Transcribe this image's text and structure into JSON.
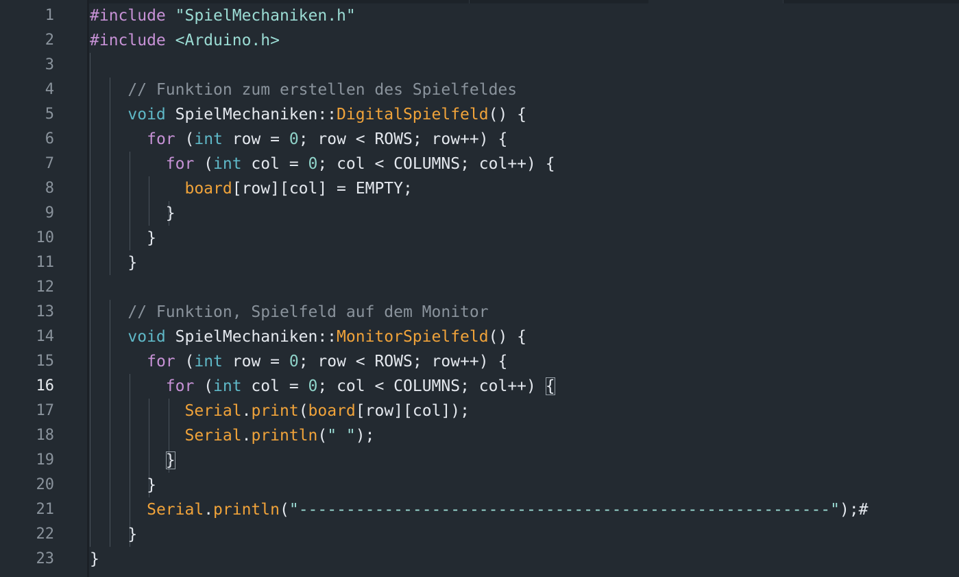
{
  "editor": {
    "active_line": 16,
    "colors": {
      "background": "#232a31",
      "keyword": "#c792d6",
      "string": "#9bdcd4",
      "type": "#5fb8c7",
      "function": "#f0a33a",
      "number": "#8fd3c9",
      "comment": "#8a939c",
      "plain": "#e4e8ee"
    },
    "lines": [
      {
        "num": "1",
        "tokens": [
          [
            "k",
            "#include"
          ],
          [
            "p",
            " "
          ],
          [
            "s",
            "\"SpielMechaniken.h\""
          ]
        ]
      },
      {
        "num": "2",
        "tokens": [
          [
            "k",
            "#include"
          ],
          [
            "p",
            " "
          ],
          [
            "s",
            "<Arduino.h>"
          ]
        ]
      },
      {
        "num": "3",
        "tokens": []
      },
      {
        "num": "4",
        "tokens": [
          [
            "p",
            "    "
          ],
          [
            "c",
            "// Funktion zum erstellen des Spielfeldes"
          ]
        ]
      },
      {
        "num": "5",
        "tokens": [
          [
            "p",
            "    "
          ],
          [
            "t",
            "void"
          ],
          [
            "p",
            " SpielMechaniken::"
          ],
          [
            "f",
            "DigitalSpielfeld"
          ],
          [
            "p",
            "() {"
          ]
        ]
      },
      {
        "num": "6",
        "tokens": [
          [
            "p",
            "      "
          ],
          [
            "k",
            "for"
          ],
          [
            "p",
            " ("
          ],
          [
            "t",
            "int"
          ],
          [
            "p",
            " row = "
          ],
          [
            "n",
            "0"
          ],
          [
            "p",
            "; row < ROWS; row++) {"
          ]
        ]
      },
      {
        "num": "7",
        "tokens": [
          [
            "p",
            "        "
          ],
          [
            "k",
            "for"
          ],
          [
            "p",
            " ("
          ],
          [
            "t",
            "int"
          ],
          [
            "p",
            " col = "
          ],
          [
            "n",
            "0"
          ],
          [
            "p",
            "; col < COLUMNS; col++) {"
          ]
        ]
      },
      {
        "num": "8",
        "tokens": [
          [
            "p",
            "          "
          ],
          [
            "f",
            "board"
          ],
          [
            "p",
            "[row][col] = EMPTY;"
          ]
        ]
      },
      {
        "num": "9",
        "tokens": [
          [
            "p",
            "        }"
          ]
        ]
      },
      {
        "num": "10",
        "tokens": [
          [
            "p",
            "      }"
          ]
        ]
      },
      {
        "num": "11",
        "tokens": [
          [
            "p",
            "    }"
          ]
        ]
      },
      {
        "num": "12",
        "tokens": []
      },
      {
        "num": "13",
        "tokens": [
          [
            "p",
            "    "
          ],
          [
            "c",
            "// Funktion, Spielfeld auf dem Monitor"
          ]
        ]
      },
      {
        "num": "14",
        "tokens": [
          [
            "p",
            "    "
          ],
          [
            "t",
            "void"
          ],
          [
            "p",
            " SpielMechaniken::"
          ],
          [
            "f",
            "MonitorSpielfeld"
          ],
          [
            "p",
            "() {"
          ]
        ]
      },
      {
        "num": "15",
        "tokens": [
          [
            "p",
            "      "
          ],
          [
            "k",
            "for"
          ],
          [
            "p",
            " ("
          ],
          [
            "t",
            "int"
          ],
          [
            "p",
            " row = "
          ],
          [
            "n",
            "0"
          ],
          [
            "p",
            "; row < ROWS; row++) {"
          ]
        ]
      },
      {
        "num": "16",
        "tokens": [
          [
            "p",
            "        "
          ],
          [
            "k",
            "for"
          ],
          [
            "p",
            " ("
          ],
          [
            "t",
            "int"
          ],
          [
            "p",
            " col = "
          ],
          [
            "n",
            "0"
          ],
          [
            "p",
            "; col < COLUMNS; col++) "
          ],
          [
            "bm",
            "{"
          ]
        ]
      },
      {
        "num": "17",
        "tokens": [
          [
            "p",
            "          "
          ],
          [
            "f",
            "Serial"
          ],
          [
            "p",
            "."
          ],
          [
            "f",
            "print"
          ],
          [
            "p",
            "("
          ],
          [
            "f",
            "board"
          ],
          [
            "p",
            "[row][col]);"
          ]
        ]
      },
      {
        "num": "18",
        "tokens": [
          [
            "p",
            "          "
          ],
          [
            "f",
            "Serial"
          ],
          [
            "p",
            "."
          ],
          [
            "f",
            "println"
          ],
          [
            "p",
            "("
          ],
          [
            "s",
            "\" \""
          ],
          [
            "p",
            ");"
          ]
        ]
      },
      {
        "num": "19",
        "tokens": [
          [
            "p",
            "        "
          ],
          [
            "bm",
            "}"
          ]
        ]
      },
      {
        "num": "20",
        "tokens": [
          [
            "p",
            "      }"
          ]
        ]
      },
      {
        "num": "21",
        "tokens": [
          [
            "p",
            "      "
          ],
          [
            "f",
            "Serial"
          ],
          [
            "p",
            "."
          ],
          [
            "f",
            "println"
          ],
          [
            "p",
            "("
          ],
          [
            "s",
            "\"--------------------------------------------------------\""
          ],
          [
            "p",
            ");#"
          ]
        ]
      },
      {
        "num": "22",
        "tokens": [
          [
            "p",
            "    }"
          ]
        ]
      },
      {
        "num": "23",
        "tokens": [
          [
            "p",
            "}"
          ]
        ]
      }
    ]
  }
}
